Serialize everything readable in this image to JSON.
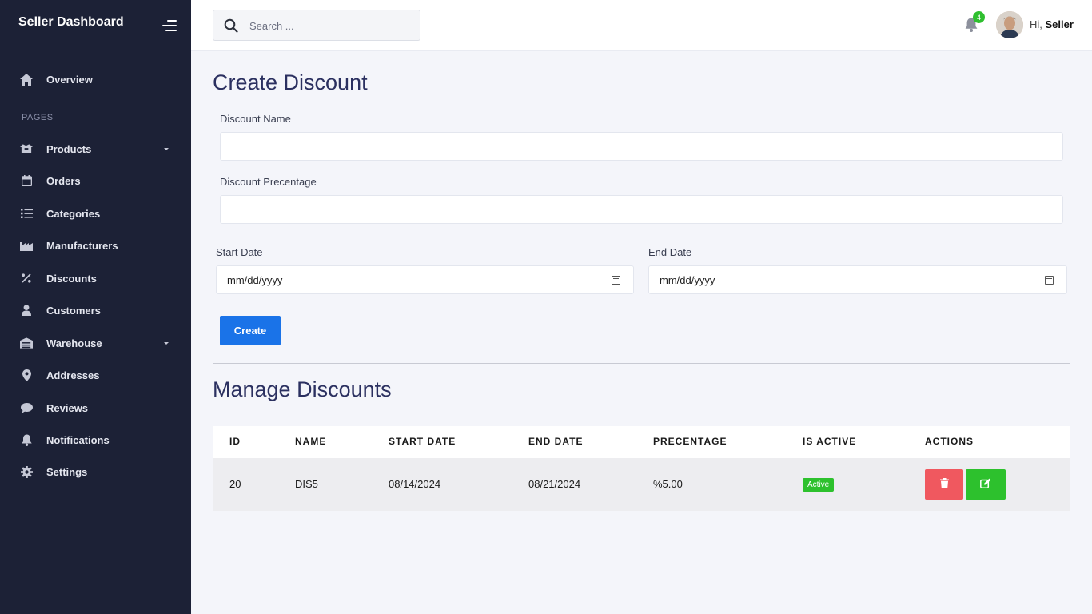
{
  "sidebar": {
    "brand": "Seller Dashboard",
    "section_label": "PAGES",
    "overview": "Overview",
    "items": [
      {
        "label": "Products",
        "icon": "box-icon",
        "has_caret": true
      },
      {
        "label": "Orders",
        "icon": "calendar-icon",
        "has_caret": false
      },
      {
        "label": "Categories",
        "icon": "list-icon",
        "has_caret": false
      },
      {
        "label": "Manufacturers",
        "icon": "factory-icon",
        "has_caret": false
      },
      {
        "label": "Discounts",
        "icon": "percent-icon",
        "has_caret": false
      },
      {
        "label": "Customers",
        "icon": "user-icon",
        "has_caret": false
      },
      {
        "label": "Warehouse",
        "icon": "warehouse-icon",
        "has_caret": true
      },
      {
        "label": "Addresses",
        "icon": "map-pin-icon",
        "has_caret": false
      },
      {
        "label": "Reviews",
        "icon": "comment-icon",
        "has_caret": false
      },
      {
        "label": "Notifications",
        "icon": "bell-icon",
        "has_caret": false
      },
      {
        "label": "Settings",
        "icon": "gear-icon",
        "has_caret": false
      }
    ]
  },
  "header": {
    "search_placeholder": "Search ...",
    "notification_count": "4",
    "greeting_prefix": "Hi, ",
    "user_name": "Seller"
  },
  "form": {
    "title": "Create Discount",
    "name_label": "Discount Name",
    "name_value": "",
    "percentage_label": "Discount Precentage",
    "percentage_value": "",
    "start_label": "Start Date",
    "start_placeholder": "mm/dd/yyyy",
    "end_label": "End Date",
    "end_placeholder": "mm/dd/yyyy",
    "submit_label": "Create"
  },
  "manage": {
    "title": "Manage Discounts",
    "columns": [
      "ID",
      "NAME",
      "START DATE",
      "END DATE",
      "PRECENTAGE",
      "IS ACTIVE",
      "ACTIONS"
    ],
    "rows": [
      {
        "id": "20",
        "name": "DIS5",
        "start": "08/14/2024",
        "end": "08/21/2024",
        "percentage": "%5.00",
        "status": "Active"
      }
    ]
  },
  "colors": {
    "sidebar_bg": "#1c2136",
    "primary": "#1a73e8",
    "success": "#2dc12d",
    "danger": "#f0585f",
    "heading": "#2b3060"
  }
}
